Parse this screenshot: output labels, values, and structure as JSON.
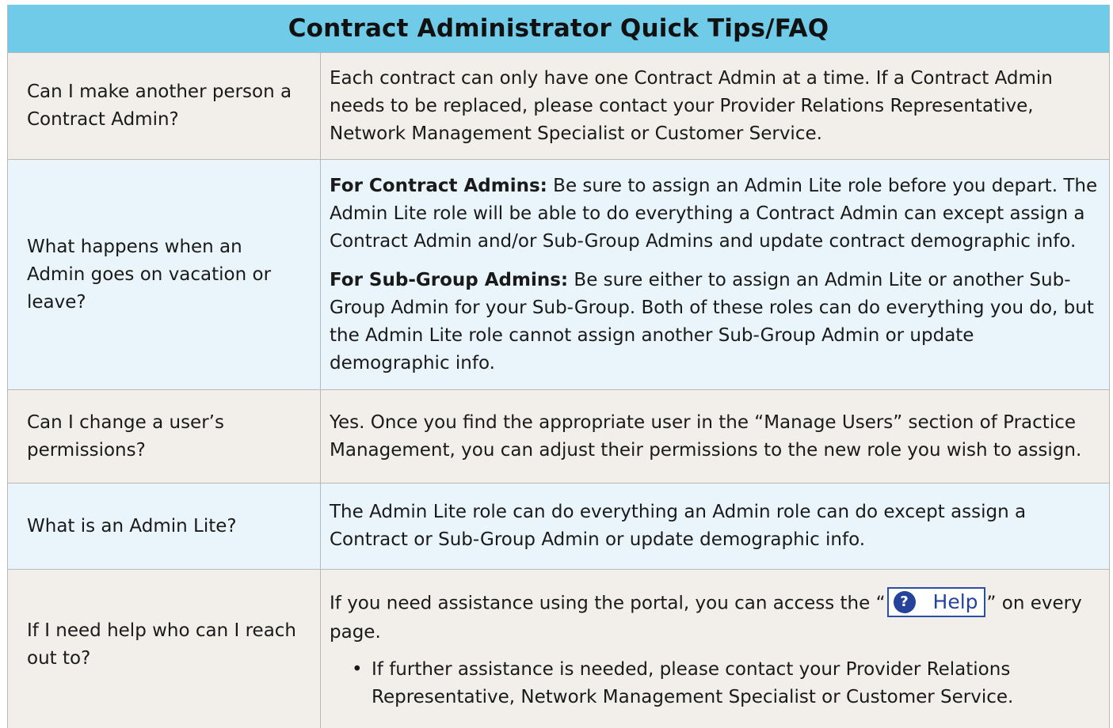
{
  "title": "Contract Administrator Quick Tips/FAQ",
  "rows": [
    {
      "question": "Can I make another person a Contract Admin?",
      "answer": "Each contract can only have one Contract Admin at a time. If a Contract Admin needs to be replaced, please contact your Provider Relations Representative, Network Management Specialist or Customer Service."
    },
    {
      "question": "What happens when an Admin goes on vacation or leave?",
      "answer_parts": [
        {
          "bold": "For Contract Admins:",
          "text": " Be sure to assign an Admin Lite role before you depart. The Admin Lite role will be able to do everything a Contract Admin can except assign a Contract Admin and/or Sub-Group Admins and update contract demographic info."
        },
        {
          "bold": "For Sub-Group Admins:",
          "text": " Be sure either to assign an Admin Lite or another Sub-Group Admin for your Sub-Group. Both of these roles can do everything you do, but the Admin Lite role cannot assign another Sub-Group Admin or update demographic info."
        }
      ]
    },
    {
      "question": "Can I change a user’s permissions?",
      "answer": "Yes. Once you find the appropriate user in the “Manage Users” section of Practice Management, you can adjust their permissions to the new role you wish to assign."
    },
    {
      "question": "What is an Admin Lite?",
      "answer": "The Admin Lite role can do everything an Admin role can do except assign a Contract or Sub-Group Admin or update demographic info."
    },
    {
      "question": "If I need help who can I reach out to?",
      "answer_before": "If you need assistance using the portal, you can access the “",
      "help_icon_glyph": "?",
      "help_label": "Help",
      "answer_after": "” on every page.",
      "bullet": "If further assistance is needed, please contact your Provider Relations Representative, Network Management Specialist or Customer Service."
    }
  ]
}
